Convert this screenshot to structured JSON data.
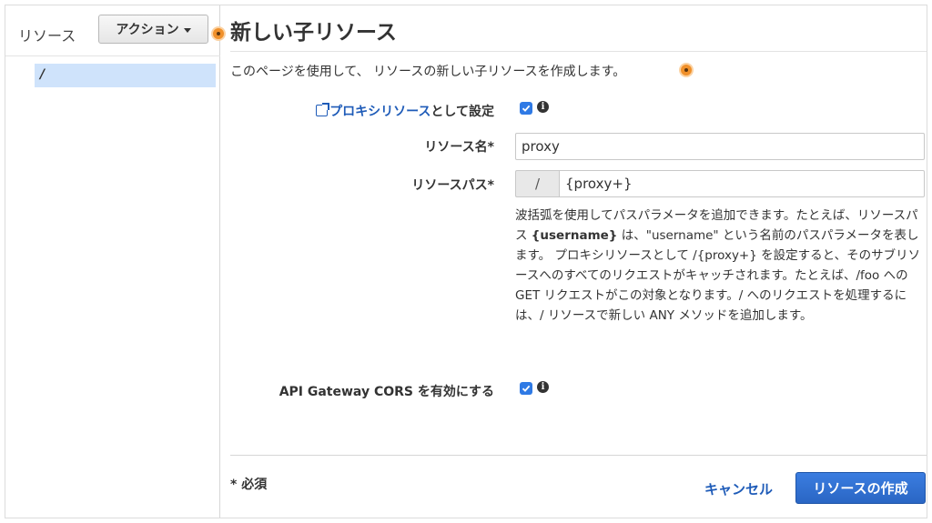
{
  "sidebar": {
    "title": "リソース",
    "actions_label": "アクション",
    "tree": [
      {
        "label": "/"
      }
    ]
  },
  "main": {
    "title": "新しい子リソース",
    "description": "このページを使用して、 リソースの新しい子リソースを作成します。",
    "proxy": {
      "link_text": "プロキシリソース",
      "label_suffix": "として設定",
      "checked": true
    },
    "resource_name": {
      "label": "リソース名*",
      "value": "proxy"
    },
    "resource_path": {
      "label": "リソースパス*",
      "prefix": "/",
      "value": "{proxy+}"
    },
    "help": {
      "part1": "波括弧を使用してパスパラメータを追加できます。たとえば、リソースパス ",
      "bold": "{username}",
      "part2": " は、\"username\" という名前のパスパラメータを表します。 プロキシリソースとして /{proxy+} を設定すると、そのサブリソースへのすべてのリクエストがキャッチされます。たとえば、/foo への GET リクエストがこの対象となります。/ へのリクエストを処理するには、/ リソースで新しい ANY メソッドを追加します。"
    },
    "cors": {
      "label": "API Gateway CORS を有効にする",
      "checked": true
    },
    "required_note": "* 必須",
    "cancel_label": "キャンセル",
    "create_label": "リソースの作成"
  },
  "colors": {
    "accent": "#2a66c4",
    "link": "#1e5bb8",
    "tree_selected": "#cfe3fb",
    "highlight_dot": "#f0902a"
  }
}
